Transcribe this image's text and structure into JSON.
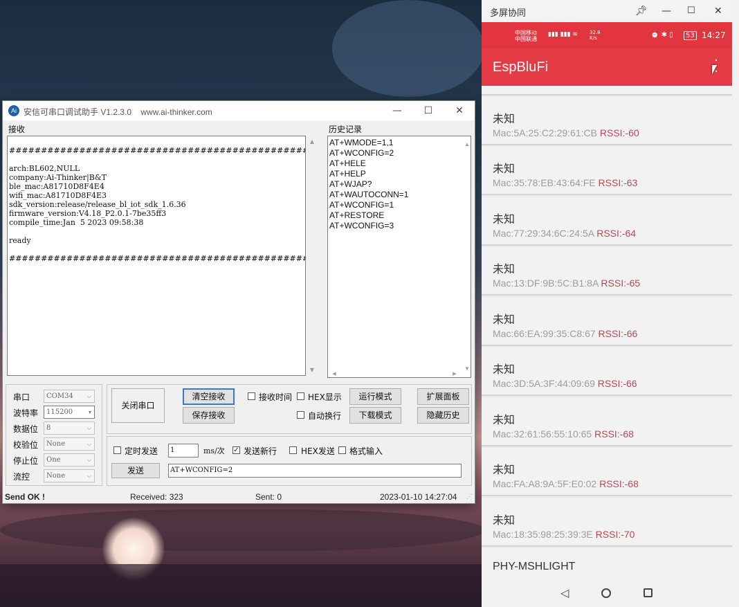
{
  "serial": {
    "title": "安信可串口调试助手 V1.2.3.0    www.ai-thinker.com",
    "icon_text": "Ai",
    "minimize": "—",
    "maximize": "☐",
    "close": "✕",
    "receive_label": "接收",
    "history_label": "历史记录",
    "received_text": "################################################\n\narch:BL602,NULL\ncompany:Ai-Thinker|B&T\nble_mac:A81710D8F4E4\nwifi_mac:A81710D8F4E3\nsdk_version:release/release_bl_iot_sdk_1.6.36\nfirmware_version:V4.18_P2.0.1-7be35ff3\ncompile_time:Jan  5 2023 09:58:38\n\nready\n\n################################################",
    "history": [
      "AT+WMODE=1,1",
      "AT+WCONFIG=2",
      "AT+HELE",
      "AT+HELP",
      "AT+WJAP?",
      "AT+WAUTOCONN=1",
      "AT+WCONFIG=1",
      "AT+RESTORE",
      "AT+WCONFIG=3"
    ],
    "settings": [
      {
        "label": "串口",
        "value": "COM34"
      },
      {
        "label": "波特率",
        "value": "115200"
      },
      {
        "label": "数据位",
        "value": "8"
      },
      {
        "label": "校验位",
        "value": "None"
      },
      {
        "label": "停止位",
        "value": "One"
      },
      {
        "label": "流控",
        "value": "None"
      }
    ],
    "close_port": "关闭串口",
    "clear_rx": "清空接收",
    "save_rx": "保存接收",
    "rx_time": "接收时间",
    "hex_show": "HEX显示",
    "auto_wrap": "自动换行",
    "run_mode": "运行模式",
    "download_mode": "下载模式",
    "expand_panel": "扩展面板",
    "hide_history": "隐藏历史",
    "timed_send": "定时发送",
    "interval": "1",
    "interval_unit": "ms/次",
    "send_newline": "发送新行",
    "send_newline_checked": "✓",
    "hex_send": "HEX发送",
    "format_input": "格式输入",
    "send": "发送",
    "send_text": "AT+WCONFIG=2",
    "status_left": "Send OK !",
    "status_received": "Received: 323",
    "status_sent": "Sent: 0",
    "status_time": "2023-01-10 14:27:04"
  },
  "phone": {
    "window_title": "多屏协同",
    "status_carrier1": "中国移动",
    "status_carrier2": "中国联通",
    "status_speed": "32.8",
    "status_speed_unit": "K/s",
    "status_battery": "53",
    "status_time": "14:27",
    "app_title": "EspBluFi",
    "devices": [
      {
        "name": "未知",
        "mac": "Mac:5A:25:C2:29:61:CB",
        "rssi": "RSSI:-60"
      },
      {
        "name": "未知",
        "mac": "Mac:35:78:EB:43:64:FE",
        "rssi": "RSSI:-63"
      },
      {
        "name": "未知",
        "mac": "Mac:77:29:34:6C:24:5A",
        "rssi": "RSSI:-64"
      },
      {
        "name": "未知",
        "mac": "Mac:13:DF:9B:5C:B1:8A",
        "rssi": "RSSI:-65"
      },
      {
        "name": "未知",
        "mac": "Mac:66:EA:99:35:C8:67",
        "rssi": "RSSI:-66"
      },
      {
        "name": "未知",
        "mac": "Mac:3D:5A:3F:44:09:69",
        "rssi": "RSSI:-66"
      },
      {
        "name": "未知",
        "mac": "Mac:32:61:56:55:10:65",
        "rssi": "RSSI:-68"
      },
      {
        "name": "未知",
        "mac": "Mac:FA:A8:9A:5F:E0:02",
        "rssi": "RSSI:-68"
      },
      {
        "name": "未知",
        "mac": "Mac:18:35:98:25:39:3E",
        "rssi": "RSSI:-70"
      },
      {
        "name": "PHY-MSHLIGHT",
        "mac": "",
        "rssi": ""
      }
    ],
    "colors": {
      "accent": "#e43b45",
      "rssi": "#b54a52"
    }
  }
}
